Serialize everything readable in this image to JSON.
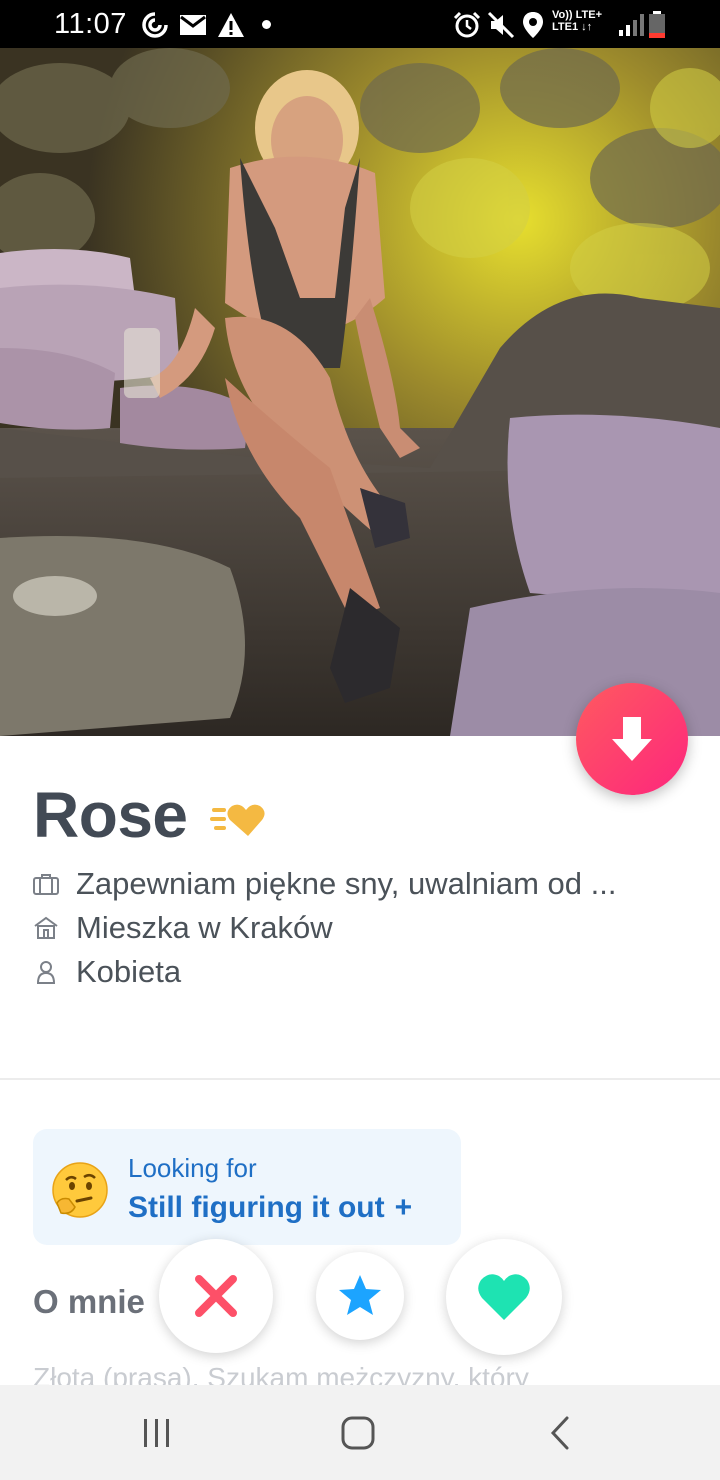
{
  "status_bar": {
    "time": "11:07",
    "network_line1": "Vo)) LTE+",
    "network_line2": "LTE1 ↓↑",
    "icons": [
      "sync-icon",
      "mail-icon",
      "warning-icon",
      "notification-dot",
      "alarm-icon",
      "mute-icon",
      "location-icon",
      "signal-icon",
      "battery-icon"
    ]
  },
  "profile": {
    "name": "Rose",
    "job": "Zapewniam piękne sny, uwalniam od ...",
    "city": "Mieszka w Kraków",
    "gender": "Kobieta"
  },
  "looking_for": {
    "title": "Looking for",
    "value": "Still figuring it out",
    "plus": "+"
  },
  "about": {
    "heading": "O mnie",
    "text": "Złota (prasa). Szukam mężczyzny, który"
  },
  "actions": [
    "nope-button",
    "super-like-button",
    "like-button"
  ],
  "nav": [
    "recents-button",
    "home-button",
    "back-button"
  ],
  "colors": {
    "brand_gradient_start": "#ff5a5f",
    "brand_gradient_end": "#fd267d",
    "nope": "#fd5068",
    "super_like": "#1ca4ff",
    "like": "#1ee3b2",
    "looking_for_text": "#1f6fc5",
    "badge": "#f4b942"
  }
}
